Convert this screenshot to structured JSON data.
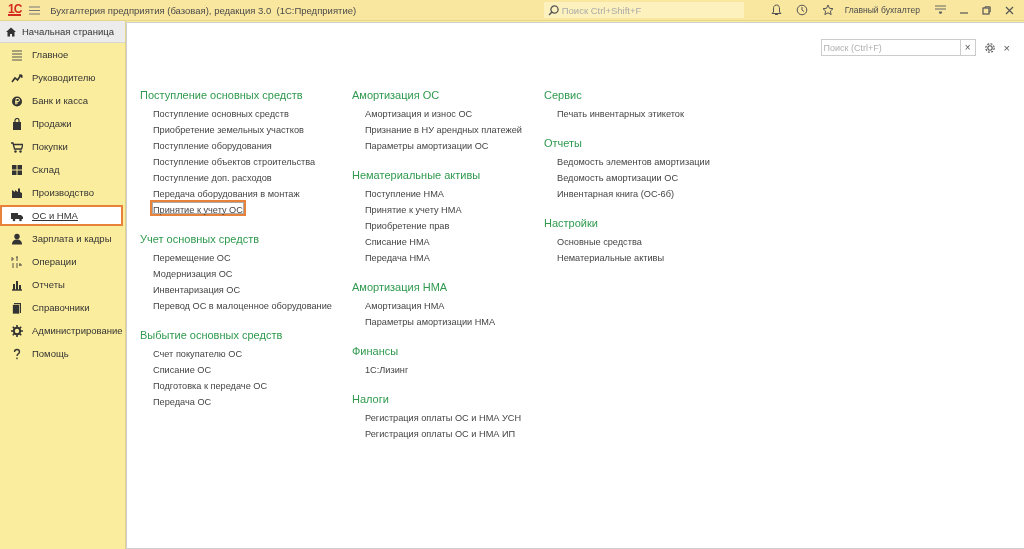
{
  "window": {
    "logo": "1С",
    "title": "Бухгалтерия предприятия (базовая), редакция 3.0  (1С:Предприятие)",
    "search": {
      "placeholder": "Поиск Ctrl+Shift+F"
    },
    "user": "Главный бухгалтер"
  },
  "home_tab": {
    "label": "Начальная страница"
  },
  "sidebar": {
    "items": [
      {
        "label": "Главное",
        "selected": false,
        "highlighted": false
      },
      {
        "label": "Руководителю",
        "selected": false,
        "highlighted": false
      },
      {
        "label": "Банк и касса",
        "selected": false,
        "highlighted": false
      },
      {
        "label": "Продажи",
        "selected": false,
        "highlighted": false
      },
      {
        "label": "Покупки",
        "selected": false,
        "highlighted": false
      },
      {
        "label": "Склад",
        "selected": false,
        "highlighted": false
      },
      {
        "label": "Производство",
        "selected": false,
        "highlighted": false
      },
      {
        "label": "ОС и НМА",
        "selected": true,
        "highlighted": true
      },
      {
        "label": "Зарплата и кадры",
        "selected": false,
        "highlighted": false
      },
      {
        "label": "Операции",
        "selected": false,
        "highlighted": false
      },
      {
        "label": "Отчеты",
        "selected": false,
        "highlighted": false
      },
      {
        "label": "Справочники",
        "selected": false,
        "highlighted": false
      },
      {
        "label": "Администрирование",
        "selected": false,
        "highlighted": false
      },
      {
        "label": "Помощь",
        "selected": false,
        "highlighted": false
      }
    ]
  },
  "panel": {
    "search": {
      "placeholder": "Поиск (Ctrl+F)"
    },
    "clear_button": "×",
    "close_button": "×",
    "columns": [
      [
        {
          "title": "Поступление основных средств",
          "links": [
            {
              "label": "Поступление основных средств",
              "highlighted": false
            },
            {
              "label": "Приобретение земельных участков",
              "highlighted": false
            },
            {
              "label": "Поступление оборудования",
              "highlighted": false
            },
            {
              "label": "Поступление объектов строительства",
              "highlighted": false
            },
            {
              "label": "Поступление доп. расходов",
              "highlighted": false
            },
            {
              "label": "Передача оборудования в монтаж",
              "highlighted": false
            },
            {
              "label": "Принятие к учету ОС",
              "highlighted": true
            }
          ]
        },
        {
          "title": "Учет основных средств",
          "links": [
            {
              "label": "Перемещение ОС",
              "highlighted": false
            },
            {
              "label": "Модернизация ОС",
              "highlighted": false
            },
            {
              "label": "Инвентаризация ОС",
              "highlighted": false
            },
            {
              "label": "Перевод ОС в малоценное оборудование",
              "highlighted": false
            }
          ]
        },
        {
          "title": "Выбытие основных средств",
          "links": [
            {
              "label": "Счет покупателю ОС",
              "highlighted": false
            },
            {
              "label": "Списание ОС",
              "highlighted": false
            },
            {
              "label": "Подготовка к передаче ОС",
              "highlighted": false
            },
            {
              "label": "Передача ОС",
              "highlighted": false
            }
          ]
        }
      ],
      [
        {
          "title": "Амортизация ОС",
          "links": [
            {
              "label": "Амортизация и износ ОС",
              "highlighted": false
            },
            {
              "label": "Признание в НУ арендных платежей",
              "highlighted": false
            },
            {
              "label": "Параметры амортизации ОС",
              "highlighted": false
            }
          ]
        },
        {
          "title": "Нематериальные активы",
          "links": [
            {
              "label": "Поступление НМА",
              "highlighted": false
            },
            {
              "label": "Принятие к учету НМА",
              "highlighted": false
            },
            {
              "label": "Приобретение прав",
              "highlighted": false
            },
            {
              "label": "Списание НМА",
              "highlighted": false
            },
            {
              "label": "Передача НМА",
              "highlighted": false
            }
          ]
        },
        {
          "title": "Амортизация НМА",
          "links": [
            {
              "label": "Амортизация НМА",
              "highlighted": false
            },
            {
              "label": "Параметры амортизации НМА",
              "highlighted": false
            }
          ]
        },
        {
          "title": "Финансы",
          "links": [
            {
              "label": "1С:Лизинг",
              "highlighted": false
            }
          ]
        },
        {
          "title": "Налоги",
          "links": [
            {
              "label": "Регистрация оплаты ОС и НМА УСН",
              "highlighted": false
            },
            {
              "label": "Регистрация оплаты ОС и НМА ИП",
              "highlighted": false
            }
          ]
        }
      ],
      [
        {
          "title": "Сервис",
          "links": [
            {
              "label": "Печать инвентарных этикеток",
              "highlighted": false
            }
          ]
        },
        {
          "title": "Отчеты",
          "links": [
            {
              "label": "Ведомость элементов амортизации",
              "highlighted": false
            },
            {
              "label": "Ведомость амортизации ОС",
              "highlighted": false
            },
            {
              "label": "Инвентарная книга (ОС-6б)",
              "highlighted": false
            }
          ]
        },
        {
          "title": "Настройки",
          "links": [
            {
              "label": "Основные средства",
              "highlighted": false
            },
            {
              "label": "Нематериальные активы",
              "highlighted": false
            }
          ]
        }
      ]
    ]
  }
}
